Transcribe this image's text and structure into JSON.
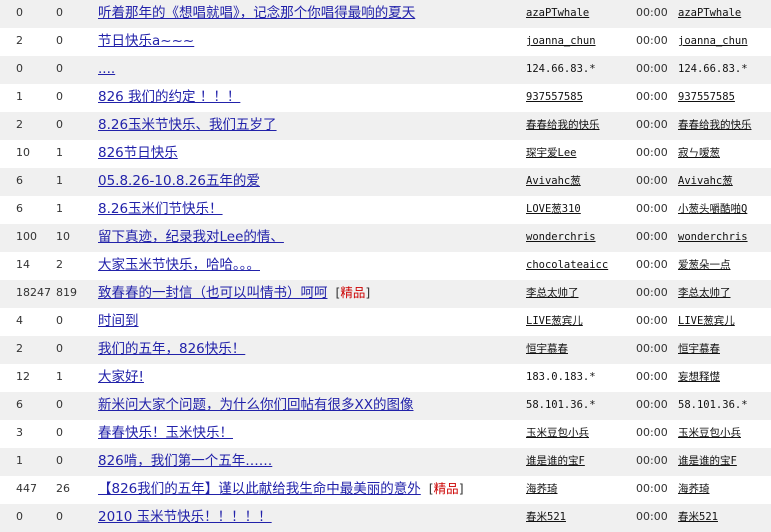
{
  "threads": [
    {
      "replies": "0",
      "views": "0",
      "title": "听着那年的《想唱就唱》，记念那个你唱得最响的夏天",
      "author": "azaPTwhale",
      "author_link": true,
      "time": "00:00",
      "last_poster": "azaPTwhale",
      "last_link": true
    },
    {
      "replies": "2",
      "views": "0",
      "title": "节日快乐a~~~",
      "author": "joanna_chun",
      "author_link": true,
      "time": "00:00",
      "last_poster": "joanna_chun",
      "last_link": true
    },
    {
      "replies": "0",
      "views": "0",
      "title": "....",
      "author": "124.66.83.*",
      "author_link": false,
      "time": "00:00",
      "last_poster": "124.66.83.*",
      "last_link": false
    },
    {
      "replies": "1",
      "views": "0",
      "title": "826 我们的约定 ！！！",
      "author": "937557585",
      "author_link": true,
      "time": "00:00",
      "last_poster": "937557585",
      "last_link": true
    },
    {
      "replies": "2",
      "views": "0",
      "title": "8.26玉米节快乐、我们五岁了",
      "author": "春春给我的快乐",
      "author_link": true,
      "time": "00:00",
      "last_poster": "春春给我的快乐",
      "last_link": true
    },
    {
      "replies": "10",
      "views": "1",
      "title": "826节日快乐",
      "author": "琛宇爱Lee",
      "author_link": true,
      "time": "00:00",
      "last_poster": "寂ㄣ嗳葱",
      "last_link": true
    },
    {
      "replies": "6",
      "views": "1",
      "title": "05.8.26-10.8.26五年的爱",
      "author": "Avivahc葱",
      "author_link": true,
      "time": "00:00",
      "last_poster": "Avivahc葱",
      "last_link": true
    },
    {
      "replies": "6",
      "views": "1",
      "title": "8.26玉米们节快乐！",
      "author": "LOVE葱310",
      "author_link": true,
      "time": "00:00",
      "last_poster": "小葱头嚼酷啪Q",
      "last_link": true
    },
    {
      "replies": "100",
      "views": "10",
      "title": "留下真迹，纪录我对Lee的情、",
      "author": "wonderchris",
      "author_link": true,
      "time": "00:00",
      "last_poster": "wonderchris",
      "last_link": true
    },
    {
      "replies": "14",
      "views": "2",
      "title": "大家玉米节快乐，哈哈。。。",
      "author": "chocolateaicc",
      "author_link": true,
      "time": "00:00",
      "last_poster": "爱葱朵一点",
      "last_link": true
    },
    {
      "replies": "18247",
      "views": "819",
      "title": "致春春的一封信（也可以叫情书）呵呵",
      "tag": "精品",
      "author": "李总太帅了",
      "author_link": true,
      "time": "00:00",
      "last_poster": "李总太帅了",
      "last_link": true
    },
    {
      "replies": "4",
      "views": "0",
      "title": "时间到",
      "author": "LIVE葱宾儿",
      "author_link": true,
      "time": "00:00",
      "last_poster": "LIVE葱宾儿",
      "last_link": true
    },
    {
      "replies": "2",
      "views": "0",
      "title": "我们的五年，826快乐！",
      "author": "恒宇慕春",
      "author_link": true,
      "time": "00:00",
      "last_poster": "恒宇慕春",
      "last_link": true
    },
    {
      "replies": "12",
      "views": "1",
      "title": "大家好!",
      "author": "183.0.183.*",
      "author_link": false,
      "time": "00:00",
      "last_poster": "妄想释憷",
      "last_link": true
    },
    {
      "replies": "6",
      "views": "0",
      "title": "新米问大家个问题，为什么你们回帖有很多XX的图像",
      "author": "58.101.36.*",
      "author_link": false,
      "time": "00:00",
      "last_poster": "58.101.36.*",
      "last_link": false
    },
    {
      "replies": "3",
      "views": "0",
      "title": "春春快乐！玉米快乐！",
      "author": "玉米豆包小兵",
      "author_link": true,
      "time": "00:00",
      "last_poster": "玉米豆包小兵",
      "last_link": true
    },
    {
      "replies": "1",
      "views": "0",
      "title": "826啃，我们第一个五年……",
      "author": "谁是谁的宝F",
      "author_link": true,
      "time": "00:00",
      "last_poster": "谁是谁的宝F",
      "last_link": true
    },
    {
      "replies": "447",
      "views": "26",
      "title": "【826我们的五年】谨以此献给我生命中最美丽的意外",
      "tag": "精品",
      "author": "海荞琦",
      "author_link": true,
      "time": "00:00",
      "last_poster": "海荞琦",
      "last_link": true
    },
    {
      "replies": "0",
      "views": "0",
      "title": "2010 玉米节快乐！！！！！",
      "author": "春米521",
      "author_link": true,
      "time": "00:00",
      "last_poster": "春米521",
      "last_link": true
    }
  ]
}
